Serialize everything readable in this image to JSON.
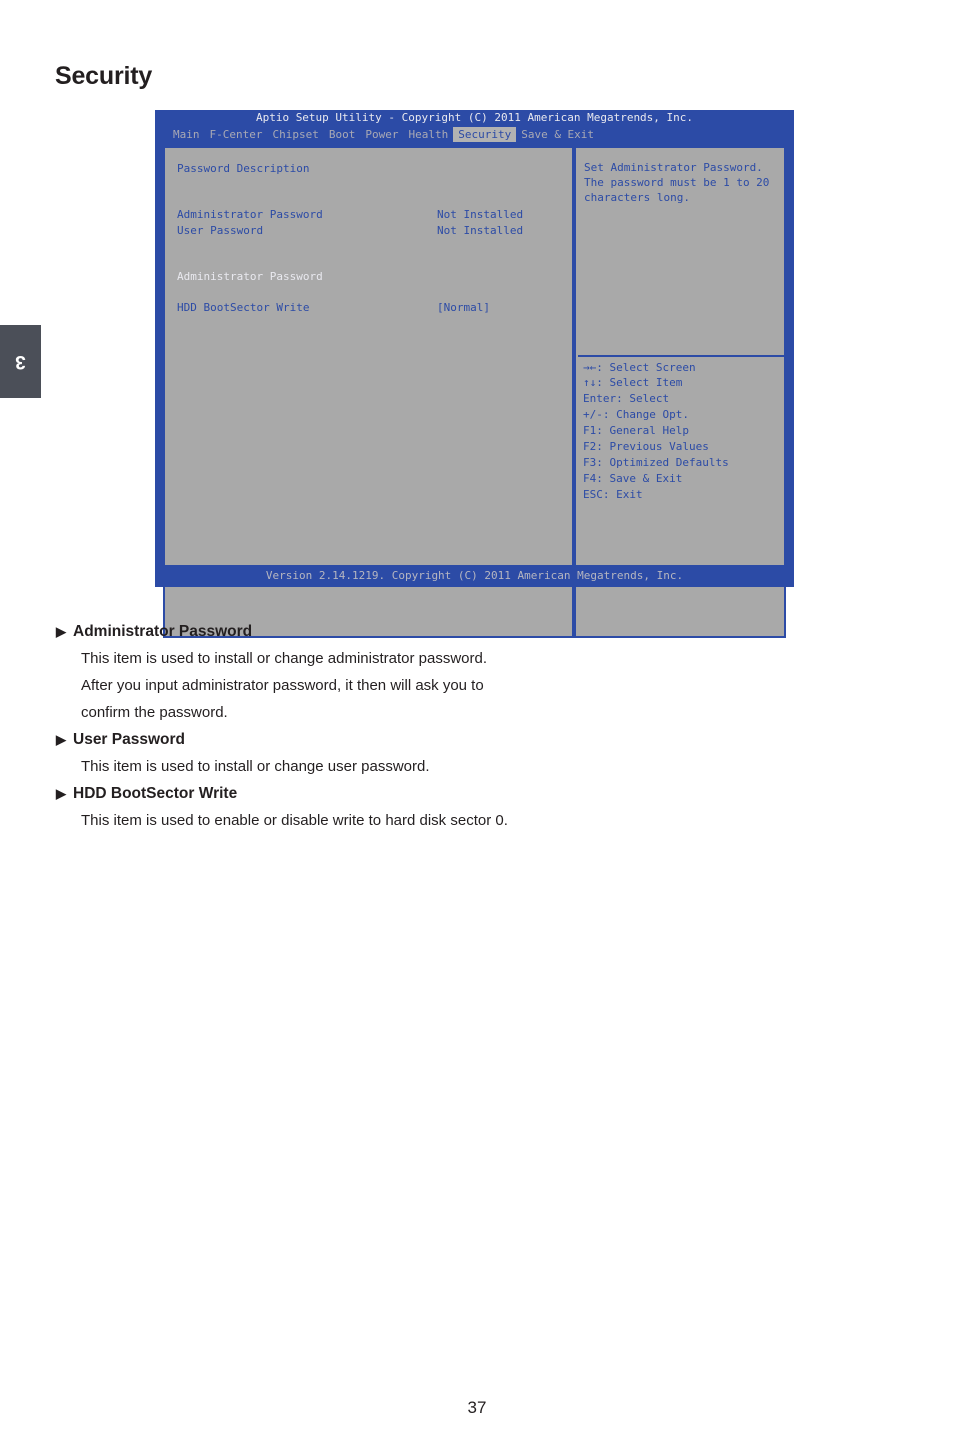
{
  "page": {
    "title": "Security",
    "chapter_tab": "3",
    "page_number": "37"
  },
  "bios": {
    "titlebar": "Aptio Setup Utility - Copyright (C) 2011 American Megatrends, Inc.",
    "menu": [
      {
        "label": "Main",
        "active": false
      },
      {
        "label": "F-Center",
        "active": false
      },
      {
        "label": "Chipset",
        "active": false
      },
      {
        "label": "Boot",
        "active": false
      },
      {
        "label": "Power",
        "active": false
      },
      {
        "label": "Health",
        "active": false
      },
      {
        "label": "Security",
        "active": true
      },
      {
        "label": "Save & Exit",
        "active": false
      }
    ],
    "left_panel": {
      "heading": "Password Description",
      "rows": [
        {
          "label": "Administrator Password",
          "value": "Not Installed",
          "style": "blue"
        },
        {
          "label": "User Password",
          "value": "Not Installed",
          "style": "blue"
        }
      ],
      "action_item": "Administrator Password",
      "setting": {
        "label": "HDD BootSector Write",
        "value": "[Normal]"
      }
    },
    "help": {
      "lines": [
        "Set Administrator Password.",
        "The password must be 1 to 20",
        "characters long."
      ]
    },
    "nav_keys": [
      "→←: Select Screen",
      "↑↓: Select Item",
      "Enter: Select",
      "+/-: Change Opt.",
      "F1: General Help",
      "F2: Previous Values",
      "F3: Optimized Defaults",
      "F4: Save & Exit",
      "ESC: Exit"
    ],
    "footer": "Version 2.14.1219. Copyright (C) 2011 American Megatrends, Inc."
  },
  "content": {
    "bullet": "▶",
    "items": [
      {
        "title": "Administrator Password",
        "lines": [
          "This item is used to install or change administrator password.",
          "After you input administrator password, it then will ask you to",
          "confirm the password."
        ]
      },
      {
        "title": "User Password",
        "lines": [
          "This item is used to install or change user password."
        ]
      },
      {
        "title": "HDD BootSector Write",
        "lines": [
          "This item is used to enable or disable write to hard disk sector 0."
        ]
      }
    ]
  },
  "colors": {
    "bios_blue": "#2c4ba6",
    "bios_gray": "#a9a9a9",
    "tab_gray": "#4b4f58",
    "text_dark": "#231f20"
  }
}
